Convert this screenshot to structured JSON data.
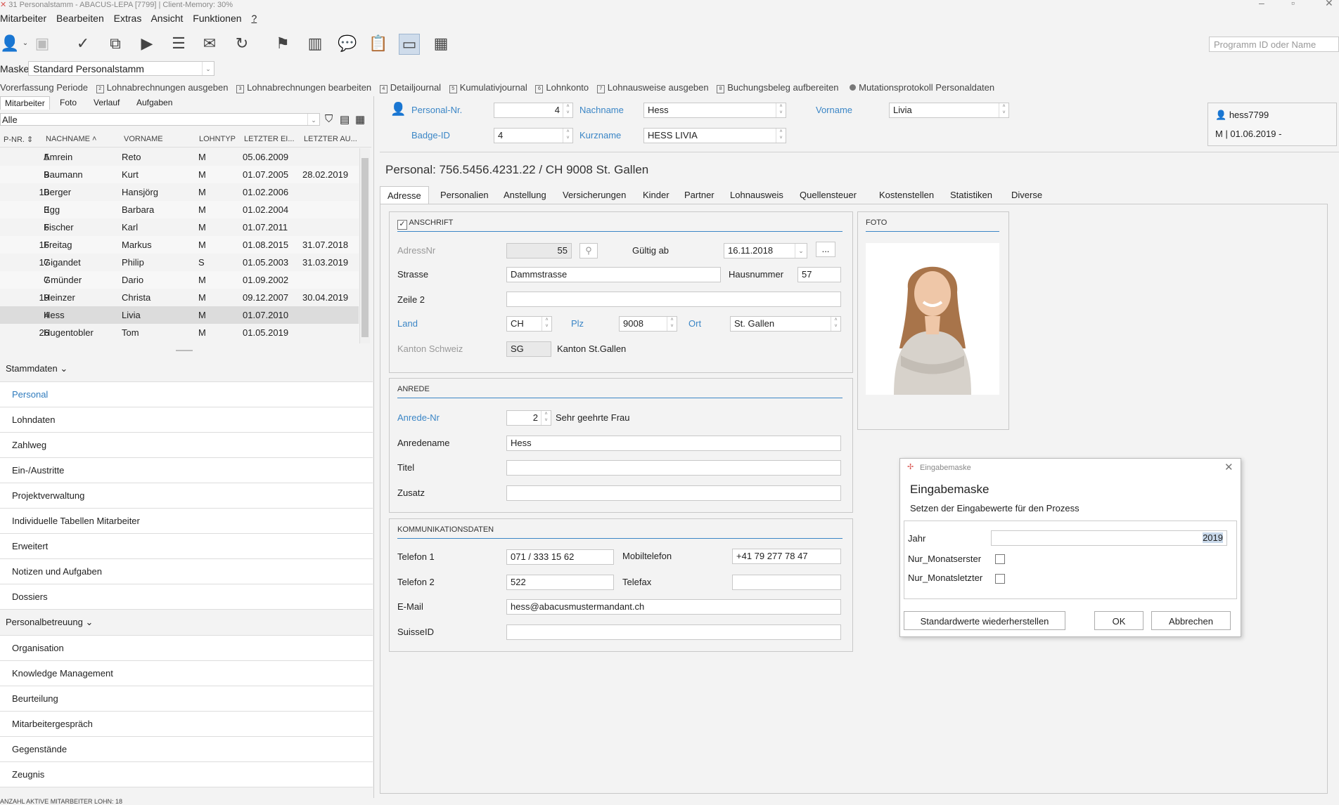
{
  "window": {
    "title": "31 Personalstamm - ABACUS-LEPA [7799] | Client-Memory: 30%"
  },
  "menu": [
    "Mitarbeiter",
    "Bearbeiten",
    "Extras",
    "Ansicht",
    "Funktionen",
    "?"
  ],
  "program_search": {
    "placeholder": "Programm ID oder Name"
  },
  "maske": {
    "label": "Maske",
    "value": "Standard Personalstamm"
  },
  "actions": [
    "Vorerfassung Periode",
    "Lohnabrechnungen ausgeben",
    "Lohnabrechnungen bearbeiten",
    "Detailjournal",
    "Kumulativjournal",
    "Lohnkonto",
    "Lohnausweise ausgeben",
    "Buchungsbeleg aufbereiten",
    "Mutationsprotokoll Personaldaten"
  ],
  "left": {
    "tabs": [
      "Mitarbeiter",
      "Foto",
      "Verlauf",
      "Aufgaben"
    ],
    "filter": "Alle",
    "columns": [
      "P-NR.",
      "NACHNAME",
      "VORNAME",
      "LOHNTYP",
      "LETZTER EI...",
      "LETZTER AU..."
    ],
    "rows": [
      {
        "nr": "5",
        "nachname": "Amrein",
        "vorname": "Reto",
        "lohntyp": "M",
        "ein": "05.06.2009",
        "aus": ""
      },
      {
        "nr": "9",
        "nachname": "Baumann",
        "vorname": "Kurt",
        "lohntyp": "M",
        "ein": "01.07.2005",
        "aus": "28.02.2019"
      },
      {
        "nr": "10",
        "nachname": "Berger",
        "vorname": "Hansjörg",
        "lohntyp": "M",
        "ein": "01.02.2006",
        "aus": ""
      },
      {
        "nr": "3",
        "nachname": "Egg",
        "vorname": "Barbara",
        "lohntyp": "M",
        "ein": "01.02.2004",
        "aus": ""
      },
      {
        "nr": "6",
        "nachname": "Fischer",
        "vorname": "Karl",
        "lohntyp": "M",
        "ein": "01.07.2011",
        "aus": ""
      },
      {
        "nr": "16",
        "nachname": "Freitag",
        "vorname": "Markus",
        "lohntyp": "M",
        "ein": "01.08.2015",
        "aus": "31.07.2018"
      },
      {
        "nr": "17",
        "nachname": "Gigandet",
        "vorname": "Philip",
        "lohntyp": "S",
        "ein": "01.05.2003",
        "aus": "31.03.2019"
      },
      {
        "nr": "7",
        "nachname": "Gmünder",
        "vorname": "Dario",
        "lohntyp": "M",
        "ein": "01.09.2002",
        "aus": ""
      },
      {
        "nr": "19",
        "nachname": "Heinzer",
        "vorname": "Christa",
        "lohntyp": "M",
        "ein": "09.12.2007",
        "aus": "30.04.2019"
      },
      {
        "nr": "4",
        "nachname": "Hess",
        "vorname": "Livia",
        "lohntyp": "M",
        "ein": "01.07.2010",
        "aus": ""
      },
      {
        "nr": "26",
        "nachname": "Hugentobler",
        "vorname": "Tom",
        "lohntyp": "M",
        "ein": "01.05.2019",
        "aus": ""
      }
    ],
    "nav": [
      {
        "section": "Stammdaten",
        "items": [
          "Personal",
          "Lohndaten",
          "Zahlweg",
          "Ein-/Austritte",
          "Projektverwaltung",
          "Individuelle Tabellen Mitarbeiter",
          "Erweitert",
          "Notizen und Aufgaben",
          "Dossiers"
        ]
      },
      {
        "section": "Personalbetreuung",
        "items": [
          "Organisation",
          "Knowledge Management",
          "Beurteilung",
          "Mitarbeitergespräch",
          "Gegenstände",
          "Zeugnis"
        ]
      }
    ],
    "status": "ANZAHL AKTIVE MITARBEITER LOHN: 18"
  },
  "header": {
    "personal_nr_label": "Personal-Nr.",
    "personal_nr": "4",
    "nachname_label": "Nachname",
    "nachname": "Hess",
    "vorname_label": "Vorname",
    "vorname": "Livia",
    "badge_label": "Badge-ID",
    "badge": "4",
    "kurzname_label": "Kurzname",
    "kurzname": "HESS LIVIA",
    "user": "hess7799",
    "user_info": "M | 01.06.2019 -"
  },
  "personal_title": "Personal: 756.5456.4231.22 / CH 9008 St. Gallen",
  "tabs": [
    "Adresse",
    "Personalien",
    "Anstellung",
    "Versicherungen",
    "Kinder",
    "Partner",
    "Lohnausweis",
    "Quellensteuer",
    "Kostenstellen",
    "Statistiken",
    "Diverse"
  ],
  "anschrift": {
    "title": "ANSCHRIFT",
    "adressnr_label": "AdressNr",
    "adressnr": "55",
    "gueltig_label": "Gültig ab",
    "gueltig": "16.11.2018",
    "more": "...",
    "strasse_label": "Strasse",
    "strasse": "Dammstrasse",
    "hausnr_label": "Hausnummer",
    "hausnr": "57",
    "zeile2_label": "Zeile 2",
    "zeile2": "",
    "land_label": "Land",
    "land": "CH",
    "plz_label": "Plz",
    "plz": "9008",
    "ort_label": "Ort",
    "ort": "St. Gallen",
    "kanton_label": "Kanton Schweiz",
    "kanton": "SG",
    "kanton_name": "Kanton St.Gallen"
  },
  "anrede": {
    "title": "ANREDE",
    "nr_label": "Anrede-Nr",
    "nr": "2",
    "nr_text": "Sehr geehrte Frau",
    "name_label": "Anredename",
    "name": "Hess",
    "titel_label": "Titel",
    "titel": "",
    "zusatz_label": "Zusatz",
    "zusatz": ""
  },
  "komm": {
    "title": "KOMMUNIKATIONSDATEN",
    "tel1_label": "Telefon 1",
    "tel1": "071 / 333 15 62",
    "mobil_label": "Mobiltelefon",
    "mobil": "+41 79 277 78 47",
    "tel2_label": "Telefon 2",
    "tel2": "522",
    "fax_label": "Telefax",
    "fax": "",
    "email_label": "E-Mail",
    "email": "hess@abacusmustermandant.ch",
    "suisse_label": "SuisseID",
    "suisse": ""
  },
  "foto": {
    "title": "FOTO"
  },
  "dialog": {
    "window_title": "Eingabemaske",
    "heading": "Eingabemaske",
    "subtitle": "Setzen der Eingabewerte für den Prozess",
    "jahr_label": "Jahr",
    "jahr": "2019",
    "first_label": "Nur_Monatserster",
    "last_label": "Nur_Monatsletzter",
    "reset": "Standardwerte wiederherstellen",
    "ok": "OK",
    "cancel": "Abbrechen"
  },
  "colors": {
    "accent": "#3b86c6",
    "selected_row": "#dcdcdc",
    "dialog_icon": "#d9534f"
  }
}
